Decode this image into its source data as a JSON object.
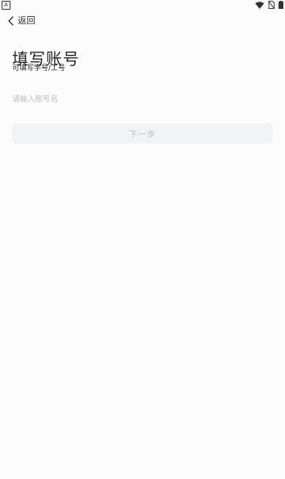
{
  "status_bar": {
    "left_icon": "A",
    "right_icons": [
      "wifi-icon",
      "no-sim-icon",
      "battery-icon"
    ]
  },
  "header": {
    "back_label": "返回",
    "back_icon": "chevron-left-icon"
  },
  "main": {
    "title": "填写账号",
    "hint": "可填写学号/工号",
    "account_input": {
      "placeholder": "请输入账号名",
      "value": ""
    },
    "next_button_label": "下一步"
  },
  "colors": {
    "background": "#fcfcfd",
    "button_bg_disabled": "#f2f3f6",
    "button_text_disabled": "#b9bbc1",
    "placeholder": "#b9bbc0"
  }
}
